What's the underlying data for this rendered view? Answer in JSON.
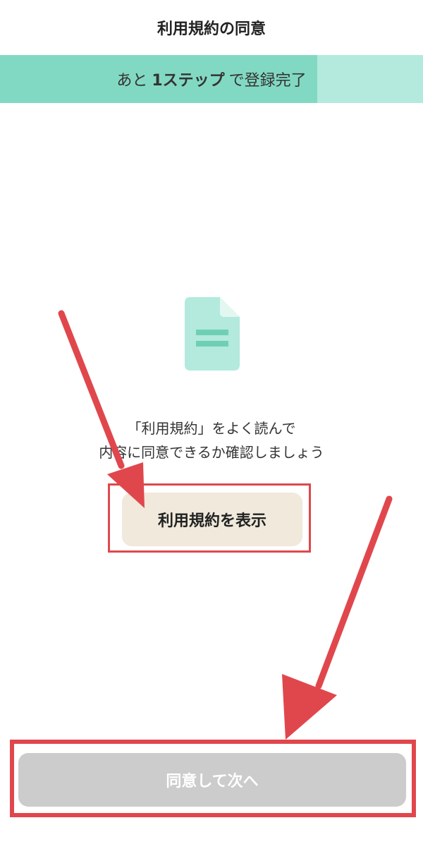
{
  "header": {
    "title": "利用規約の同意"
  },
  "progress": {
    "prefix": "あと",
    "step": "1ステップ",
    "suffix": "で登録完了",
    "fraction": 0.75
  },
  "main": {
    "icon": "document-icon",
    "description_line1": "「利用規約」をよく読んで",
    "description_line2": "内容に同意できるか確認しましょう",
    "terms_button_label": "利用規約を表示"
  },
  "footer": {
    "agree_button_label": "同意して次へ"
  },
  "colors": {
    "progress_track": "#b3eadd",
    "progress_fill": "#82d9c3",
    "terms_button_bg": "#f0e9dc",
    "agree_button_disabled_bg": "#cccccc",
    "annotation_red": "#e0474c"
  }
}
